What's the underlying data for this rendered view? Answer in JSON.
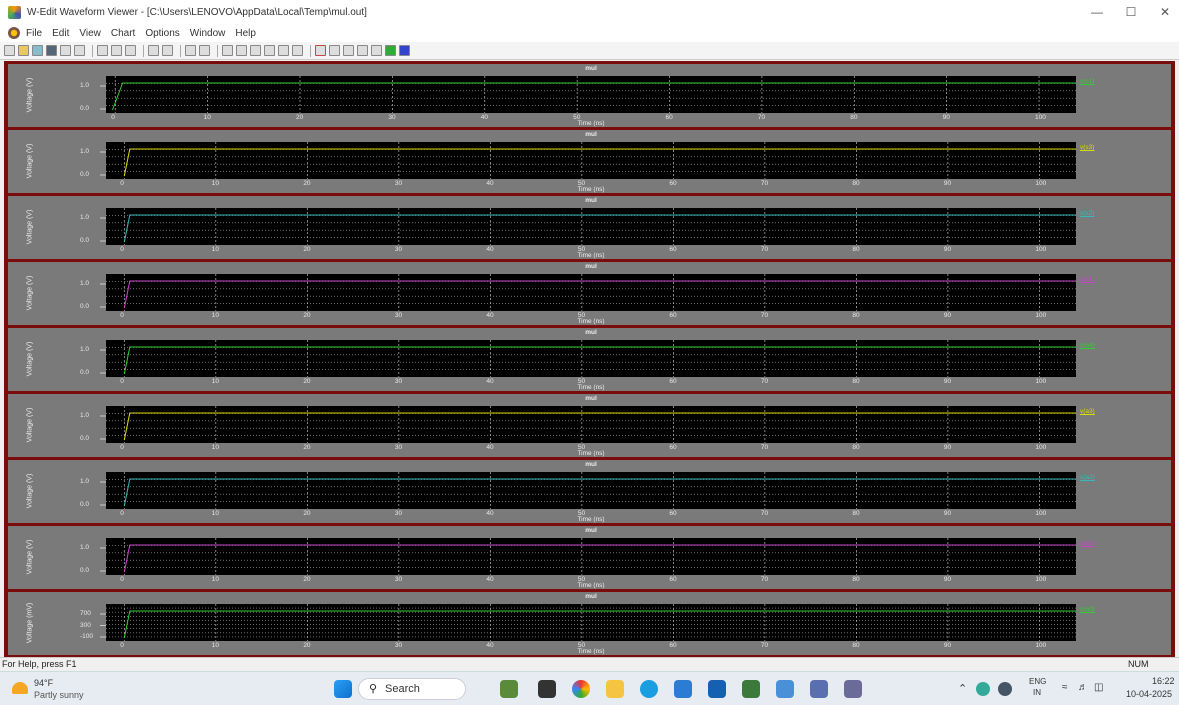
{
  "window": {
    "title": "W-Edit Waveform Viewer - [C:\\Users\\LENOVO\\AppData\\Local\\Temp\\mul.out]",
    "minimize_icon": "minimize-icon",
    "maximize_icon": "maximize-icon",
    "close_icon": "close-icon"
  },
  "menu": {
    "items": [
      "File",
      "Edit",
      "View",
      "Chart",
      "Options",
      "Window",
      "Help"
    ]
  },
  "colors": {
    "background": "#000000",
    "panel_bg": "#7a7a7a",
    "divider": "#7b0c0c",
    "green": "#33cc33",
    "yellow": "#dddd00",
    "cyan": "#33bbbb",
    "magenta": "#cc44cc"
  },
  "chart_data": [
    {
      "type": "line",
      "title": "mul",
      "xlabel": "Time (ns)",
      "ylabel": "Voltage (V)",
      "x_ticks": [
        0,
        10,
        20,
        30,
        40,
        50,
        60,
        70,
        80,
        90,
        100
      ],
      "y_ticks": [
        "1.0",
        "0.0"
      ],
      "xlim": [
        -1,
        104
      ],
      "series": [
        {
          "name": "v(s1)",
          "color": "#33cc33",
          "x": [
            -0.3,
            0.8,
            104
          ],
          "y": [
            0,
            1.8,
            1.8
          ]
        }
      ]
    },
    {
      "type": "line",
      "title": "mul",
      "xlabel": "Time (ns)",
      "ylabel": "Voltage (V)",
      "x_ticks": [
        0,
        10,
        20,
        30,
        40,
        50,
        60,
        70,
        80,
        90,
        100
      ],
      "y_ticks": [
        "1.0",
        "0.0"
      ],
      "xlim": [
        -2,
        104
      ],
      "series": [
        {
          "name": "v(s3)",
          "color": "#dddd00",
          "x": [
            0,
            0.6,
            104
          ],
          "y": [
            0,
            1.8,
            1.8
          ]
        }
      ]
    },
    {
      "type": "line",
      "title": "mul",
      "xlabel": "Time (ns)",
      "ylabel": "Voltage (V)",
      "x_ticks": [
        0,
        10,
        20,
        30,
        40,
        50,
        60,
        70,
        80,
        90,
        100
      ],
      "y_ticks": [
        "1.0",
        "0.0"
      ],
      "xlim": [
        -2,
        104
      ],
      "series": [
        {
          "name": "v(s2)",
          "color": "#33bbbb",
          "x": [
            0,
            0.6,
            104
          ],
          "y": [
            0,
            1.8,
            1.8
          ]
        }
      ]
    },
    {
      "type": "line",
      "title": "mul",
      "xlabel": "Time (ns)",
      "ylabel": "Voltage (V)",
      "x_ticks": [
        0,
        10,
        20,
        30,
        40,
        50,
        60,
        70,
        80,
        90,
        100
      ],
      "y_ticks": [
        "1.0",
        "0.0"
      ],
      "xlim": [
        -2,
        104
      ],
      "series": [
        {
          "name": "v(s1)",
          "color": "#cc44cc",
          "x": [
            0,
            0.6,
            104
          ],
          "y": [
            0,
            1.8,
            1.8
          ]
        }
      ]
    },
    {
      "type": "line",
      "title": "mul",
      "xlabel": "Time (ns)",
      "ylabel": "Voltage (V)",
      "x_ticks": [
        0,
        10,
        20,
        30,
        40,
        50,
        60,
        70,
        80,
        90,
        100
      ],
      "y_ticks": [
        "1.0",
        "0.0"
      ],
      "xlim": [
        -2,
        104
      ],
      "series": [
        {
          "name": "v(a4)",
          "color": "#33cc33",
          "x": [
            0,
            0.6,
            104
          ],
          "y": [
            0,
            1.8,
            1.8
          ]
        }
      ]
    },
    {
      "type": "line",
      "title": "mul",
      "xlabel": "Time (ns)",
      "ylabel": "Voltage (V)",
      "x_ticks": [
        0,
        10,
        20,
        30,
        40,
        50,
        60,
        70,
        80,
        90,
        100
      ],
      "y_ticks": [
        "1.0",
        "0.0"
      ],
      "xlim": [
        -2,
        104
      ],
      "series": [
        {
          "name": "v(a3)",
          "color": "#dddd00",
          "x": [
            0,
            0.6,
            104
          ],
          "y": [
            0,
            1.8,
            1.8
          ]
        }
      ]
    },
    {
      "type": "line",
      "title": "mul",
      "xlabel": "Time (ns)",
      "ylabel": "Voltage (V)",
      "x_ticks": [
        0,
        10,
        20,
        30,
        40,
        50,
        60,
        70,
        80,
        90,
        100
      ],
      "y_ticks": [
        "1.0",
        "0.0"
      ],
      "xlim": [
        -2,
        104
      ],
      "series": [
        {
          "name": "v(a2)",
          "color": "#33bbbb",
          "x": [
            0,
            0.6,
            104
          ],
          "y": [
            0,
            1.8,
            1.8
          ]
        }
      ]
    },
    {
      "type": "line",
      "title": "mul",
      "xlabel": "Time (ns)",
      "ylabel": "Voltage (V)",
      "x_ticks": [
        0,
        10,
        20,
        30,
        40,
        50,
        60,
        70,
        80,
        90,
        100
      ],
      "y_ticks": [
        "1.0",
        "0.0"
      ],
      "xlim": [
        -2,
        104
      ],
      "series": [
        {
          "name": "v(a1)",
          "color": "#cc44cc",
          "x": [
            0,
            0.6,
            104
          ],
          "y": [
            0,
            1.8,
            1.8
          ]
        }
      ]
    },
    {
      "type": "line",
      "title": "mul",
      "xlabel": "Time (ns)",
      "ylabel": "Voltage (mV)",
      "x_ticks": [
        0,
        10,
        20,
        30,
        40,
        50,
        60,
        70,
        80,
        90,
        100
      ],
      "y_ticks": [
        "700",
        "300",
        "-100"
      ],
      "xlim": [
        -2,
        104
      ],
      "series": [
        {
          "name": "v(a0)",
          "color": "#33cc33",
          "x": [
            0,
            0.6,
            104
          ],
          "y": [
            0,
            1.8,
            1.8
          ]
        }
      ]
    }
  ],
  "status": {
    "help": "For Help, press F1",
    "num": "NUM"
  },
  "taskbar": {
    "weather_temp": "94°F",
    "weather_desc": "Partly sunny",
    "search_label": "Search",
    "lang1": "ENG",
    "lang2": "IN",
    "time": "16:22",
    "date": "10-04-2025"
  }
}
